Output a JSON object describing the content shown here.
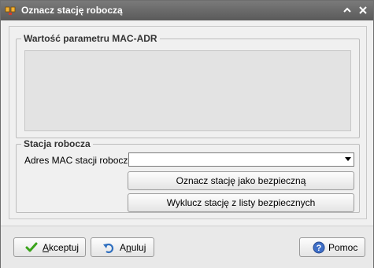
{
  "window": {
    "title": "Oznacz stację roboczą",
    "icon": "network-station-icon"
  },
  "mac_group": {
    "legend": "Wartość parametru MAC-ADR",
    "value": ""
  },
  "station_group": {
    "legend": "Stacja robocza",
    "mac_label": "Adres MAC stacji roboczej:",
    "mac_value": "",
    "mark_safe_label": "Oznacz stację jako bezpieczną",
    "exclude_label": "Wyklucz stację z listy bezpiecznych"
  },
  "footer": {
    "accept_label_u": "A",
    "accept_label_rest": "kceptuj",
    "cancel_label_pre": "A",
    "cancel_label_u": "n",
    "cancel_label_rest": "uluj",
    "help_label": "Pomoc"
  },
  "colors": {
    "accept_icon": "#3aa31b",
    "help_icon": "#3f6fc7"
  }
}
